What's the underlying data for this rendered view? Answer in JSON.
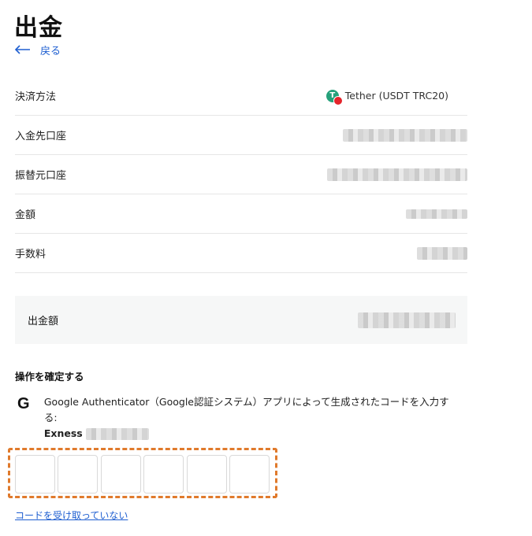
{
  "page": {
    "title": "出金",
    "back_label": "戻る"
  },
  "details": {
    "method_label": "決済方法",
    "method_value": "Tether (USDT TRC20)",
    "deposit_account_label": "入金先口座",
    "source_account_label": "振替元口座",
    "amount_label": "金額",
    "fee_label": "手数料"
  },
  "total": {
    "label": "出金額"
  },
  "confirm": {
    "heading": "操作を確定する",
    "instruction": "Google Authenticator（Google認証システム）アプリによって生成されたコードを入力する:",
    "account_prefix": "Exness",
    "code_length": 6
  },
  "links": {
    "no_code": "コードを受け取っていない"
  },
  "colors": {
    "accent_link": "#1f5fd1",
    "tether_green": "#26a17b",
    "tron_red": "#e4242b",
    "highlight_dashed": "#e07a2c"
  },
  "icons": {
    "back": "arrow-left-icon",
    "currency": "tether-icon",
    "authenticator": "google-g-icon"
  }
}
